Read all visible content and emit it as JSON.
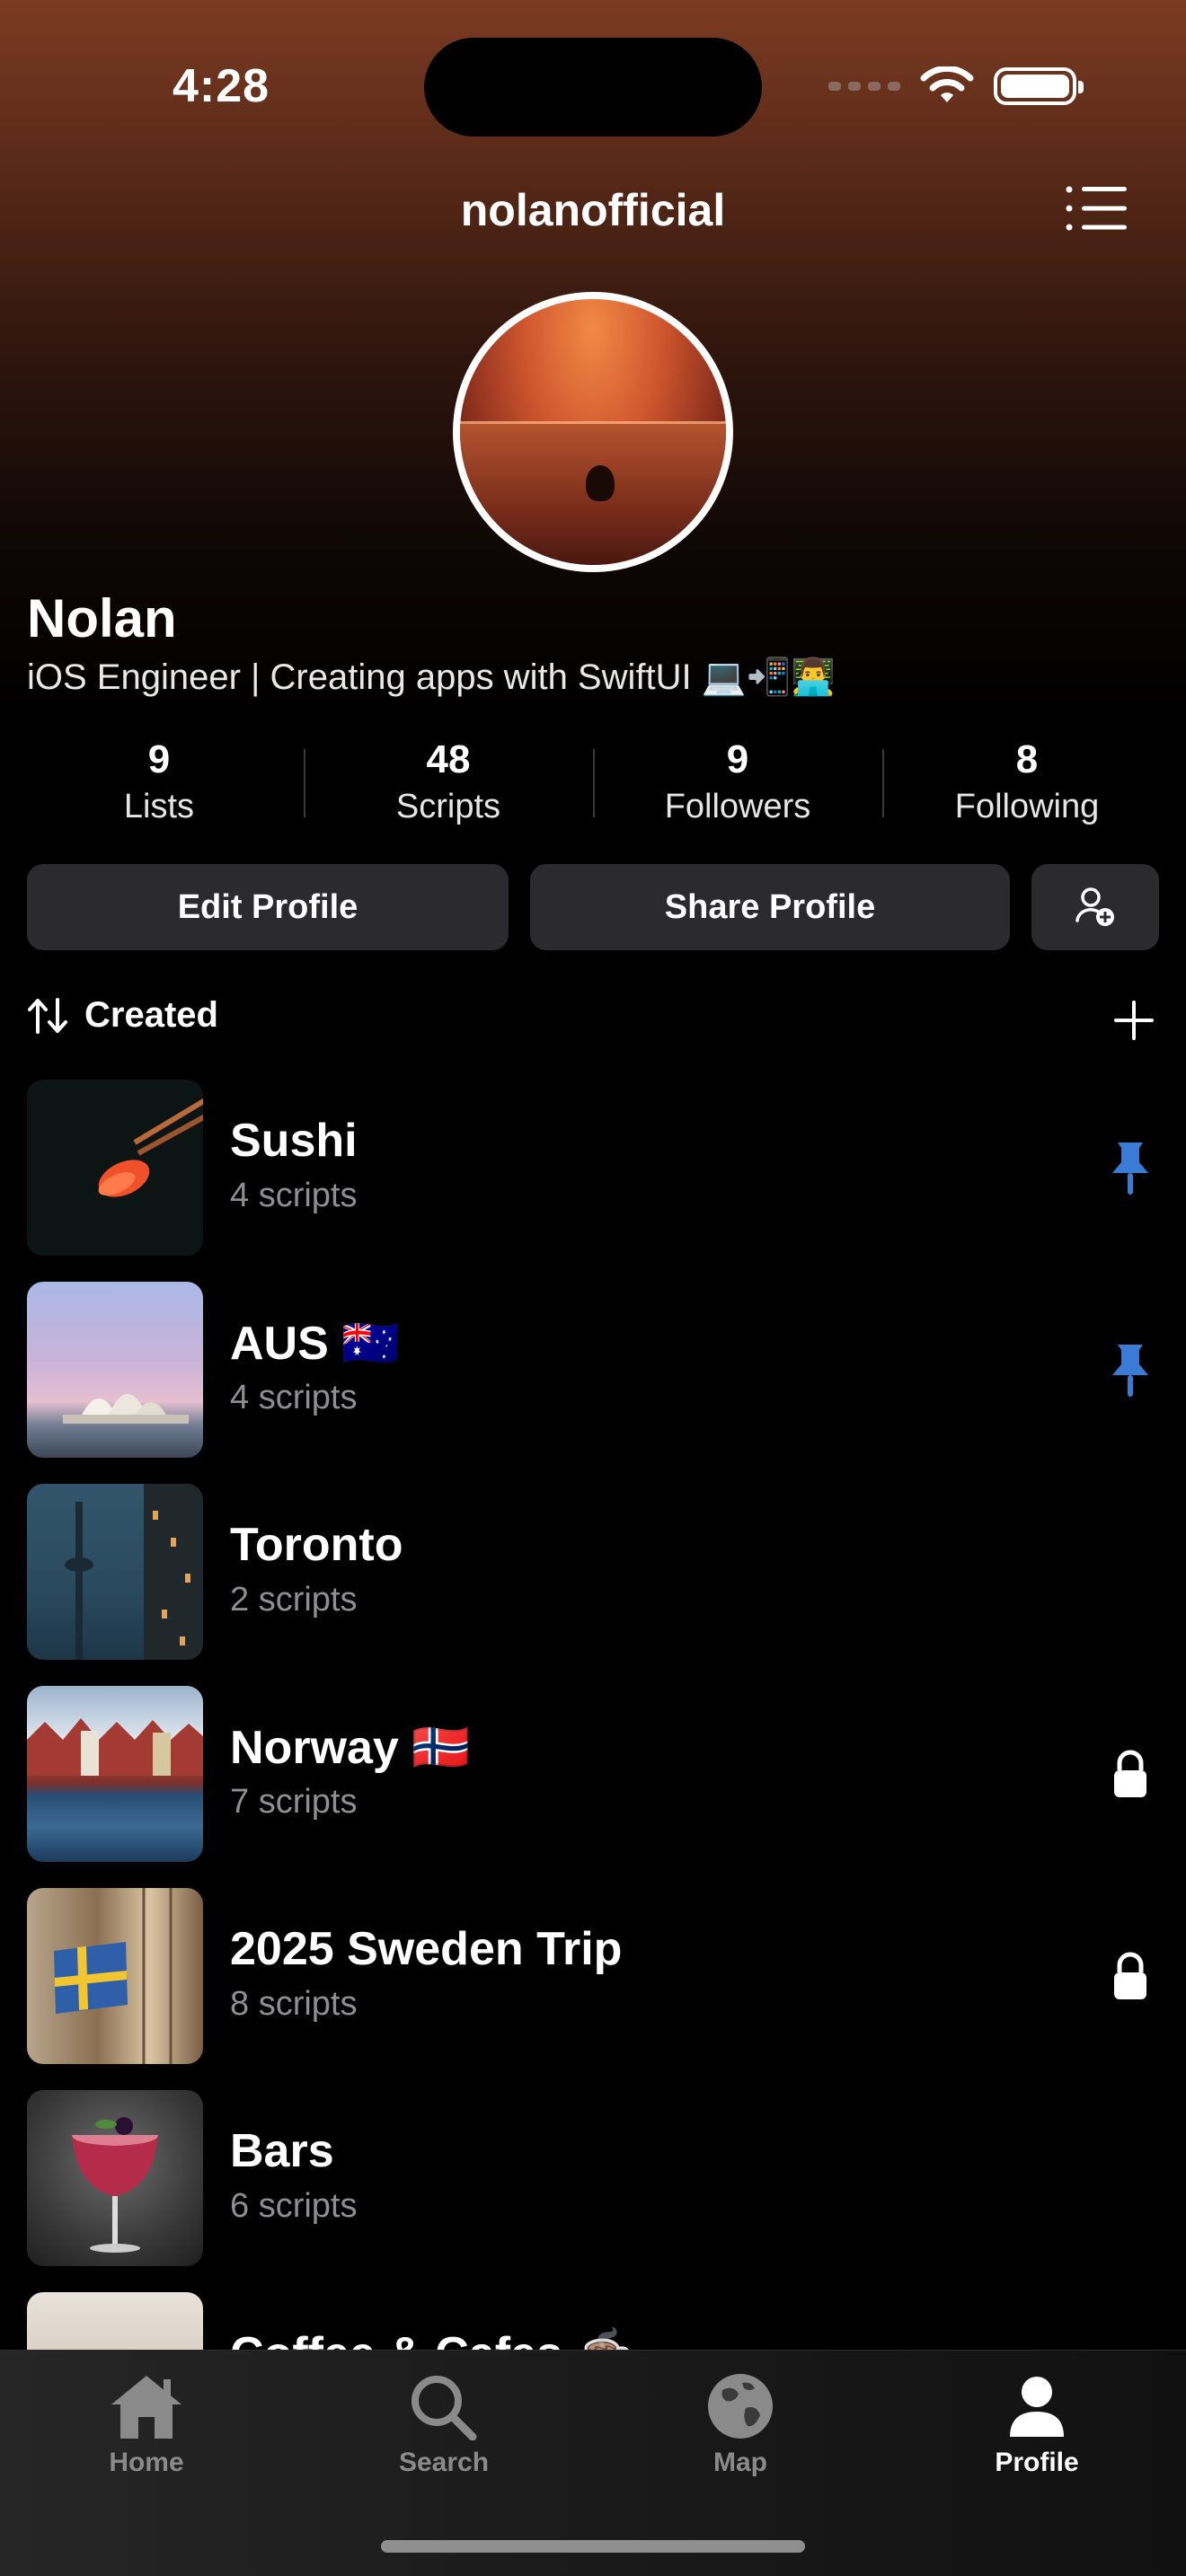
{
  "status": {
    "time": "4:28"
  },
  "header": {
    "username": "nolanofficial"
  },
  "profile": {
    "name": "Nolan",
    "bio": "iOS Engineer | Creating apps with SwiftUI 💻📲👨‍💻"
  },
  "stats": [
    {
      "value": "9",
      "label": "Lists"
    },
    {
      "value": "48",
      "label": "Scripts"
    },
    {
      "value": "9",
      "label": "Followers"
    },
    {
      "value": "8",
      "label": "Following"
    }
  ],
  "actions": {
    "edit": "Edit Profile",
    "share": "Share Profile"
  },
  "sort": {
    "label": "Created"
  },
  "lists": [
    {
      "title": "Sushi",
      "subtitle": "4 scripts",
      "badge": "pin-icon"
    },
    {
      "title": "AUS 🇦🇺",
      "subtitle": "4 scripts",
      "badge": "pin-icon"
    },
    {
      "title": "Toronto",
      "subtitle": "2 scripts",
      "badge": ""
    },
    {
      "title": "Norway 🇳🇴",
      "subtitle": "7 scripts",
      "badge": "lock-icon"
    },
    {
      "title": "2025 Sweden Trip",
      "subtitle": "8 scripts",
      "badge": "lock-icon"
    },
    {
      "title": "Bars",
      "subtitle": "6 scripts",
      "badge": ""
    },
    {
      "title": "Coffee & Cafes ☕",
      "subtitle": "",
      "badge": ""
    }
  ],
  "tabs": [
    {
      "label": "Home",
      "icon": "home-icon"
    },
    {
      "label": "Search",
      "icon": "search-icon"
    },
    {
      "label": "Map",
      "icon": "globe-icon"
    },
    {
      "label": "Profile",
      "icon": "person-icon",
      "active": true
    }
  ],
  "colors": {
    "pin": "#3a7bd5",
    "accent_bg_top": "#7b3b22",
    "button_bg": "#2b2b2d"
  }
}
